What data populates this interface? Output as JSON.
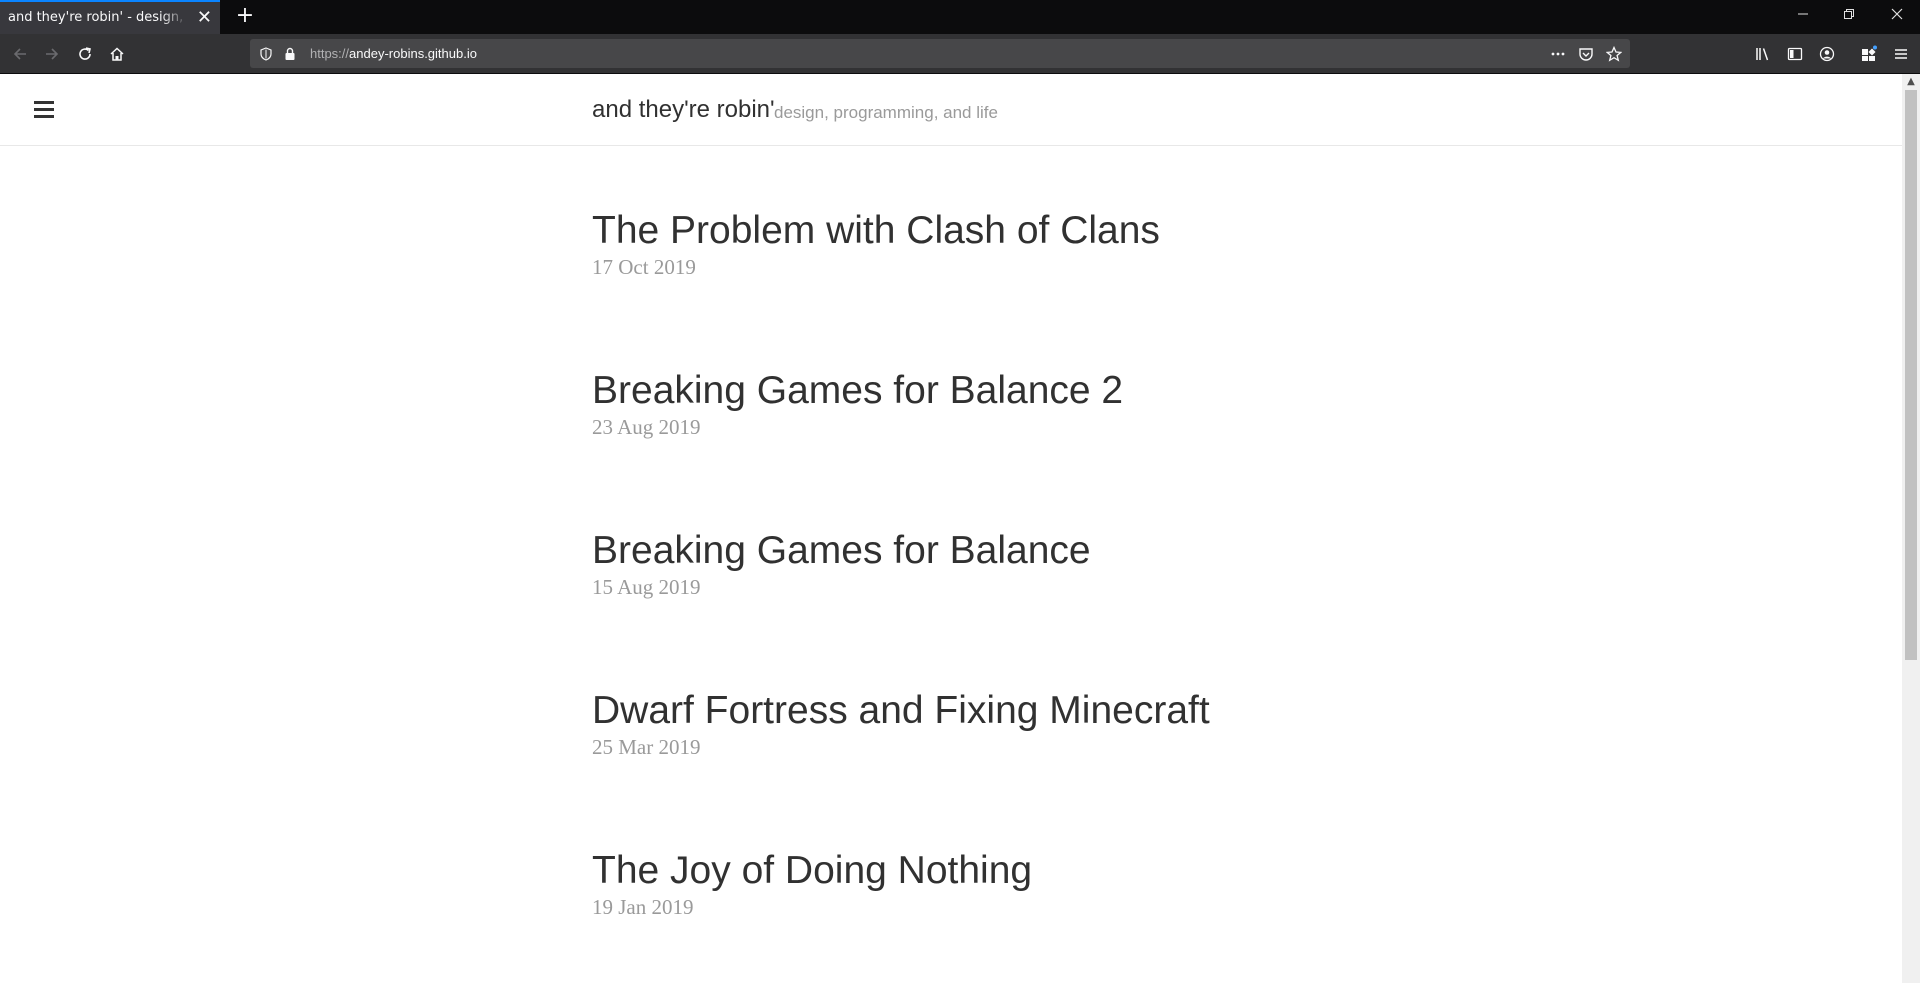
{
  "browser": {
    "tab": {
      "title": "and they're robin' - design, programming, and life"
    },
    "url": {
      "scheme": "https://",
      "host": "andey-robins.github.io"
    }
  },
  "site": {
    "title": "and they're robin'",
    "tagline": "design, programming, and life"
  },
  "posts": [
    {
      "title": "The Problem with Clash of Clans",
      "date": "17 Oct 2019"
    },
    {
      "title": "Breaking Games for Balance 2",
      "date": "23 Aug 2019"
    },
    {
      "title": "Breaking Games for Balance",
      "date": "15 Aug 2019"
    },
    {
      "title": "Dwarf Fortress and Fixing Minecraft",
      "date": "25 Mar 2019"
    },
    {
      "title": "The Joy of Doing Nothing",
      "date": "19 Jan 2019"
    }
  ]
}
